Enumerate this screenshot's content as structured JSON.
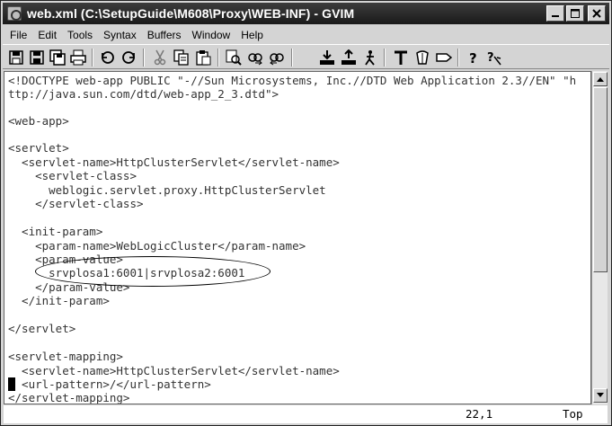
{
  "window": {
    "title": "web.xml (C:\\SetupGuide\\M608\\Proxy\\WEB-INF) - GVIM"
  },
  "menu": [
    "File",
    "Edit",
    "Tools",
    "Syntax",
    "Buffers",
    "Window",
    "Help"
  ],
  "toolbar": {
    "buttons": [
      "open-icon",
      "save-icon",
      "save-all-icon",
      "print-icon",
      "undo-icon",
      "redo-icon",
      "cut-icon",
      "copy-icon",
      "paste-icon",
      "replace-icon",
      "find-next-icon",
      "find-prev-icon",
      "load-session-icon",
      "save-session-icon",
      "run-script-icon",
      "make-icon",
      "shell-icon",
      "tag-jump-icon",
      "help-icon",
      "find-help-icon"
    ]
  },
  "editor": {
    "lines": [
      "<!DOCTYPE web-app PUBLIC \"-//Sun Microsystems, Inc.//DTD Web Application 2.3//EN\" \"h",
      "ttp://java.sun.com/dtd/web-app_2_3.dtd\">",
      "",
      "<web-app>",
      "",
      "<servlet>",
      "  <servlet-name>HttpClusterServlet</servlet-name>",
      "    <servlet-class>",
      "      weblogic.servlet.proxy.HttpClusterServlet",
      "    </servlet-class>",
      "",
      "  <init-param>",
      "    <param-name>WebLogicCluster</param-name>",
      "    <param-value>",
      "      srvplosa1:6001|srvplosa2:6001",
      "    </param-value>",
      "  </init-param>",
      "",
      "</servlet>",
      "",
      "<servlet-mapping>",
      "  <servlet-name>HttpClusterServlet</servlet-name>",
      "  <url-pattern>/</url-pattern>",
      "</servlet-mapping>"
    ],
    "cursor_line": 22
  },
  "status": {
    "position": "22,1",
    "scroll": "Top"
  }
}
